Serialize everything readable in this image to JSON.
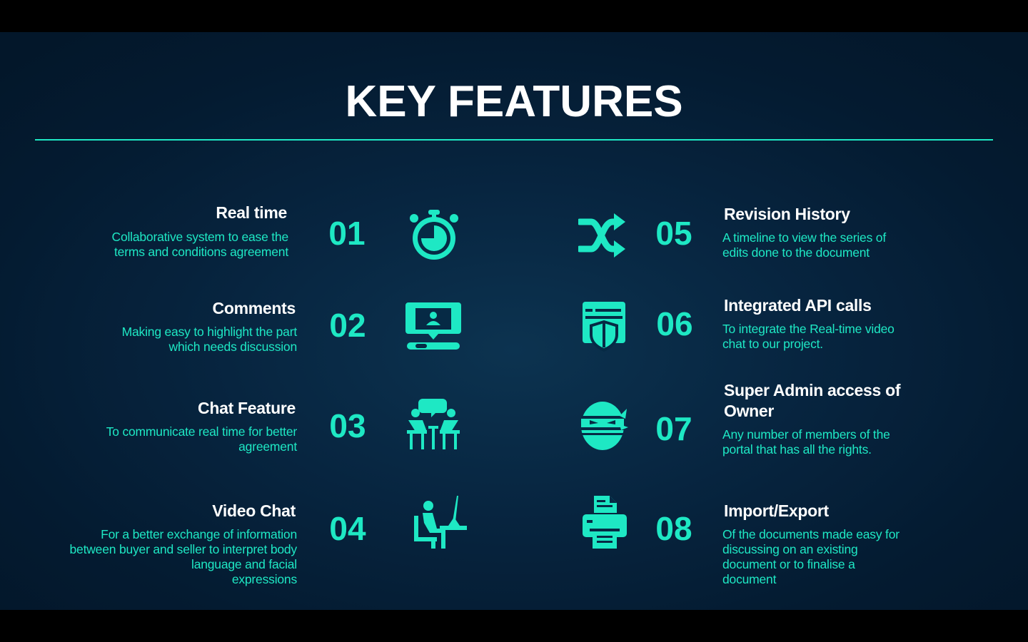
{
  "slide": {
    "title": "KEY FEATURES",
    "accent_color": "#1ee8c4",
    "background_color": "#041b31"
  },
  "features": [
    {
      "number": "01",
      "title": "Real time",
      "desc_lines": [
        "Collaborative system to ease the",
        "terms and conditions agreement"
      ],
      "icon": "stopwatch-icon"
    },
    {
      "number": "02",
      "title": "Comments",
      "desc_lines": [
        "Making easy to highlight the part",
        "which needs discussion"
      ],
      "icon": "comment-monitor-icon"
    },
    {
      "number": "03",
      "title": "Chat Feature",
      "desc_lines": [
        "To communicate real time for better",
        "agreement"
      ],
      "icon": "people-chat-icon"
    },
    {
      "number": "04",
      "title": "Video Chat",
      "desc_lines": [
        "For a better exchange of information",
        "between buyer and seller to interpret body",
        "language and facial",
        "expressions"
      ],
      "icon": "person-at-desk-icon"
    },
    {
      "number": "05",
      "title": "Revision History",
      "desc_lines": [
        "A timeline to view the series of",
        "edits done to the document"
      ],
      "icon": "shuffle-icon"
    },
    {
      "number": "06",
      "title": "Integrated API calls",
      "desc_lines": [
        "To integrate the Real-time video",
        "chat to our project."
      ],
      "icon": "browser-shield-icon"
    },
    {
      "number": "07",
      "title_lines": [
        "Super Admin access of",
        "Owner"
      ],
      "desc_lines": [
        "Any number of members of the",
        "portal that has all the rights."
      ],
      "icon": "ninja-icon"
    },
    {
      "number": "08",
      "title": "Import/Export",
      "desc_lines": [
        "Of the documents made easy for",
        "discussing on an existing",
        "document or to finalise a",
        "document"
      ],
      "icon": "printer-icon"
    }
  ]
}
